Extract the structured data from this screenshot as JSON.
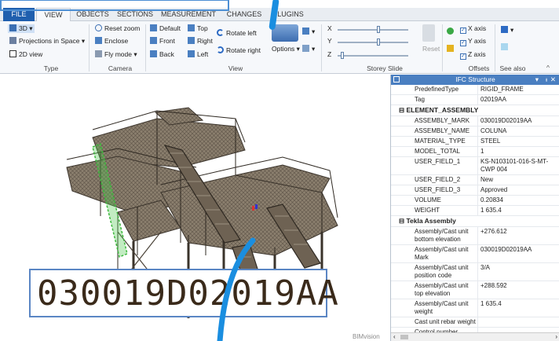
{
  "tabs": [
    "FILE",
    "VIEW",
    "OBJECTS",
    "SECTIONS",
    "MEASUREMENT",
    "CHANGES",
    "PLUGINS"
  ],
  "ribbon": {
    "type": {
      "label": "Type",
      "items": [
        "3D",
        "Projections in Space",
        "2D view"
      ]
    },
    "camera": {
      "label": "Camera",
      "items": [
        "Reset zoom",
        "Enclose",
        "Fly mode"
      ]
    },
    "view": {
      "label": "View",
      "items": [
        "Default",
        "Top",
        "Front",
        "Right",
        "Back",
        "Left",
        "Rotate left",
        "Rotate right",
        "Options"
      ]
    },
    "storey": {
      "label": "Storey Slide",
      "axes": [
        "X",
        "Y",
        "Z"
      ],
      "reset": "Reset"
    },
    "offsets": {
      "label": "Offsets",
      "items": [
        "X axis",
        "Y axis",
        "Z axis"
      ]
    },
    "seealso": {
      "label": "See also"
    }
  },
  "panel": {
    "title": "IFC Structure",
    "rows_top": [
      [
        "PredefinedType",
        "RIGID_FRAME"
      ],
      [
        "Tag",
        "02019AA"
      ]
    ],
    "section1": "ELEMENT_ASSEMBLY",
    "rows1": [
      [
        "ASSEMBLY_MARK",
        "030019D02019AA"
      ],
      [
        "ASSEMBLY_NAME",
        "COLUNA"
      ],
      [
        "MATERIAL_TYPE",
        "STEEL"
      ],
      [
        "MODEL_TOTAL",
        "1"
      ],
      [
        "USER_FIELD_1",
        "KS-N103101-016-S-MT-CWP 004"
      ],
      [
        "USER_FIELD_2",
        "New"
      ],
      [
        "USER_FIELD_3",
        "Approved"
      ],
      [
        "VOLUME",
        "0.20834"
      ],
      [
        "WEIGHT",
        "1 635.4"
      ]
    ],
    "section2": "Tekla Assembly",
    "rows2": [
      [
        "Assembly/Cast unit bottom elevation",
        "+276.612"
      ],
      [
        "Assembly/Cast unit Mark",
        "030019D02019AA"
      ],
      [
        "Assembly/Cast unit position code",
        "3/A"
      ],
      [
        "Assembly/Cast unit top elevation",
        "+288.592"
      ],
      [
        "Assembly/Cast unit weight",
        "1 635.4"
      ],
      [
        "Cast unit rebar weight",
        ""
      ],
      [
        "Control number",
        ""
      ]
    ]
  },
  "mark_overlay": "030019D02019AA",
  "watermark": "BIMvision",
  "colors": {
    "accent": "#1f5fae",
    "panel_head": "#4a7fc1",
    "highlight": "#4d8fd4",
    "model": "#6e6253"
  }
}
